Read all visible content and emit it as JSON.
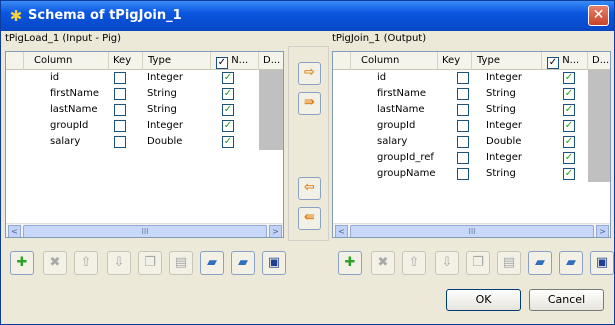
{
  "window": {
    "title": "Schema of tPigJoin_1",
    "close_symbol": "✕"
  },
  "left_panel": {
    "label": "tPigLoad_1 (Input - Pig)",
    "columns": [
      "Column",
      "Key",
      "Type",
      "N...",
      "D..."
    ],
    "rows": [
      {
        "column": "id",
        "key": false,
        "type": "Integer",
        "nullable": true
      },
      {
        "column": "firstName",
        "key": false,
        "type": "String",
        "nullable": true
      },
      {
        "column": "lastName",
        "key": false,
        "type": "String",
        "nullable": true
      },
      {
        "column": "groupId",
        "key": false,
        "type": "Integer",
        "nullable": true
      },
      {
        "column": "salary",
        "key": false,
        "type": "Double",
        "nullable": true
      }
    ],
    "scroll_left": "<",
    "scroll_right": ">",
    "scroll_thumb": "III"
  },
  "right_panel": {
    "label": "tPigJoin_1 (Output)",
    "columns": [
      "Column",
      "Key",
      "Type",
      "N...",
      "D..."
    ],
    "rows": [
      {
        "column": "id",
        "key": false,
        "type": "Integer",
        "nullable": true
      },
      {
        "column": "firstName",
        "key": false,
        "type": "String",
        "nullable": true
      },
      {
        "column": "lastName",
        "key": false,
        "type": "String",
        "nullable": true
      },
      {
        "column": "groupId",
        "key": false,
        "type": "Integer",
        "nullable": true
      },
      {
        "column": "salary",
        "key": false,
        "type": "Double",
        "nullable": true
      },
      {
        "column": "groupId_ref",
        "key": false,
        "type": "Integer",
        "nullable": true
      },
      {
        "column": "groupName",
        "key": false,
        "type": "String",
        "nullable": true
      }
    ],
    "scroll_left": "<",
    "scroll_right": ">",
    "scroll_thumb": "III"
  },
  "transfer_buttons": {
    "copy_selected_right": "⇨",
    "copy_all_right": "⇛",
    "copy_selected_left": "⇦",
    "copy_all_left": "⇚"
  },
  "toolbar_buttons": [
    {
      "name": "add",
      "icon": "plus-icon",
      "glyph": "✚",
      "color": "#2fa22a",
      "enabled": true
    },
    {
      "name": "remove",
      "icon": "x-icon",
      "glyph": "✖",
      "color": "#a8a8a8",
      "enabled": false
    },
    {
      "name": "move-up",
      "icon": "arrow-up-icon",
      "glyph": "⇧",
      "color": "#a8a8a8",
      "enabled": false
    },
    {
      "name": "move-down",
      "icon": "arrow-down-icon",
      "glyph": "⇩",
      "color": "#a8a8a8",
      "enabled": false
    },
    {
      "name": "copy",
      "icon": "copy-icon",
      "glyph": "❐",
      "color": "#a8a8a8",
      "enabled": false
    },
    {
      "name": "paste",
      "icon": "paste-icon",
      "glyph": "▤",
      "color": "#a8a8a8",
      "enabled": false
    },
    {
      "name": "import",
      "icon": "import-folder-icon",
      "glyph": "▰",
      "color": "#2f6fbf",
      "enabled": true
    },
    {
      "name": "export",
      "icon": "export-folder-icon",
      "glyph": "▰",
      "color": "#2f6fbf",
      "enabled": true
    },
    {
      "name": "save",
      "icon": "save-disk-icon",
      "glyph": "▣",
      "color": "#1f3f8f",
      "enabled": true
    }
  ],
  "footer": {
    "ok_label": "OK",
    "cancel_label": "Cancel"
  },
  "colors": {
    "title_bar": "#0a56e0",
    "dialog_bg": "#ece9d8",
    "check_green": "#21a121",
    "transfer_arrow": "#e07d12"
  }
}
